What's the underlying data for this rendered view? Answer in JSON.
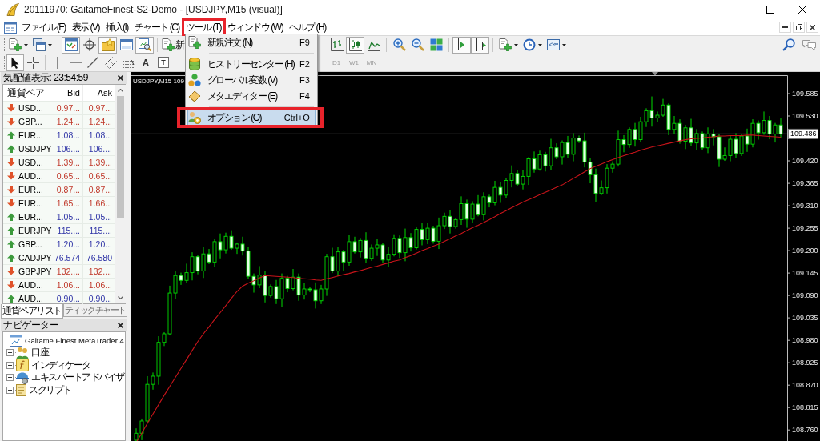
{
  "window": {
    "title": "20111970: GaitameFinest-S2-Demo - [USDJPY,M15 (visual)]"
  },
  "menu_bar": [
    {
      "label": "ファイル (F)",
      "annotated": false
    },
    {
      "label": "表示 (V)",
      "annotated": false
    },
    {
      "label": "挿入(I)",
      "annotated": false
    },
    {
      "label": "チャート (C)",
      "annotated": false
    },
    {
      "label": "ツール (T)",
      "annotated": true,
      "entries": [
        {
          "kind": "item",
          "label": "新規注文 (N)",
          "shortcut": "F9",
          "selected": false,
          "annotated": false
        },
        {
          "kind": "separator"
        },
        {
          "kind": "item",
          "label": "ヒストリーセンター (H)",
          "shortcut": "F2",
          "selected": false,
          "annotated": false
        },
        {
          "kind": "item",
          "label": "グローバル変数 (V)",
          "shortcut": "F3",
          "selected": false,
          "annotated": false
        },
        {
          "kind": "item",
          "label": "メタエディター (E)",
          "shortcut": "F4",
          "selected": false,
          "annotated": false
        },
        {
          "kind": "separator"
        },
        {
          "kind": "item",
          "label": "オプション (O)",
          "shortcut": "Ctrl+O",
          "selected": true,
          "annotated": true
        }
      ]
    },
    {
      "label": "ウィンドウ (W)",
      "annotated": false
    },
    {
      "label": "ヘルプ (H)",
      "annotated": false
    }
  ],
  "toolbar": {
    "left": [
      {
        "pressed": false
      },
      {
        "pressed": false
      },
      {
        "pressed": true
      },
      {
        "pressed": false
      },
      {
        "pressed": true
      },
      {
        "pressed": false
      },
      {
        "pressed": true
      }
    ],
    "order_button": "新",
    "right": [
      {
        "pressed": false
      },
      {
        "pressed": true
      },
      {
        "pressed": false
      },
      {
        "pressed": false
      },
      {
        "pressed": false
      },
      {
        "pressed": false
      },
      {
        "pressed": true
      },
      {
        "pressed": true
      },
      {
        "pressed": false
      },
      {
        "pressed": false
      },
      {
        "pressed": false
      }
    ]
  },
  "drawing_toolbar": {
    "tools": [
      {
        "pressed": true
      },
      {
        "pressed": false
      },
      {
        "pressed": false
      },
      {
        "pressed": false
      },
      {
        "pressed": false
      },
      {
        "pressed": false
      },
      {
        "pressed": false
      }
    ],
    "text_tools": [
      "A",
      "T"
    ],
    "periods": [
      {
        "label": "D1",
        "disabled": true
      },
      {
        "label": "W1",
        "disabled": true
      },
      {
        "label": "MN",
        "disabled": true
      }
    ]
  },
  "market_watch": {
    "title": "気配値表示: 23:54:59",
    "columns": [
      "通貨ペア",
      "Bid",
      "Ask"
    ],
    "rows": [
      {
        "symbol": "USD...",
        "bid": "0.97...",
        "ask": "0.97...",
        "rising": false
      },
      {
        "symbol": "GBP...",
        "bid": "1.24...",
        "ask": "1.24...",
        "rising": false
      },
      {
        "symbol": "EUR...",
        "bid": "1.08...",
        "ask": "1.08...",
        "rising": true
      },
      {
        "symbol": "USDJPY",
        "bid": "106....",
        "ask": "106....",
        "rising": true
      },
      {
        "symbol": "USD...",
        "bid": "1.39...",
        "ask": "1.39...",
        "rising": false
      },
      {
        "symbol": "AUD...",
        "bid": "0.65...",
        "ask": "0.65...",
        "rising": false
      },
      {
        "symbol": "EUR...",
        "bid": "0.87...",
        "ask": "0.87...",
        "rising": false
      },
      {
        "symbol": "EUR...",
        "bid": "1.65...",
        "ask": "1.66...",
        "rising": false
      },
      {
        "symbol": "EUR...",
        "bid": "1.05...",
        "ask": "1.05...",
        "rising": true
      },
      {
        "symbol": "EURJPY",
        "bid": "115....",
        "ask": "115....",
        "rising": true
      },
      {
        "symbol": "GBP...",
        "bid": "1.20...",
        "ask": "1.20...",
        "rising": true
      },
      {
        "symbol": "CADJPY",
        "bid": "76.574",
        "ask": "76.580",
        "rising": true
      },
      {
        "symbol": "GBPJPY",
        "bid": "132....",
        "ask": "132....",
        "rising": false
      },
      {
        "symbol": "AUD...",
        "bid": "1.06...",
        "ask": "1.06...",
        "rising": false
      },
      {
        "symbol": "AUD...",
        "bid": "0.90...",
        "ask": "0.90...",
        "rising": true
      }
    ],
    "tabs": [
      {
        "label": "通貨ペアリスト",
        "selected": true
      },
      {
        "label": "ティックチャート",
        "selected": false
      }
    ]
  },
  "navigator": {
    "title": "ナビゲーター",
    "root": {
      "label": "Gaitame Finest MetaTrader 4",
      "children": [
        {
          "label": "口座",
          "expanded": false
        },
        {
          "label": "インディケータ",
          "expanded": false
        },
        {
          "label": "エキスパートアドバイザ",
          "expanded": false
        },
        {
          "label": "スクリプト",
          "expanded": false
        }
      ]
    }
  },
  "chart": {
    "label": "USDJPY,M15 109",
    "chart_data": {
      "type": "candlestick",
      "categories": [
        null,
        null,
        null,
        null,
        null,
        null,
        null,
        null,
        null,
        null,
        null,
        null,
        null,
        null,
        null,
        null,
        null,
        null,
        null,
        null,
        null,
        null,
        null,
        null,
        null,
        null,
        null,
        null,
        null,
        null,
        null,
        null,
        null,
        null,
        null,
        null,
        null,
        null,
        null,
        null,
        null,
        null,
        null,
        null,
        null,
        null,
        null,
        null,
        null,
        null,
        null,
        null,
        null,
        null,
        null,
        null,
        null,
        null,
        null,
        null,
        null,
        null,
        null,
        null,
        null,
        null,
        null,
        null,
        null,
        null,
        null,
        null,
        null,
        null,
        null,
        null,
        null,
        null,
        null,
        null,
        null,
        null,
        null,
        null,
        null,
        null,
        null,
        null,
        null,
        null,
        null,
        null,
        null,
        null,
        null,
        null,
        null,
        null,
        null,
        null,
        null,
        null,
        null,
        null,
        null,
        null,
        null,
        null,
        null,
        null,
        null,
        null,
        null,
        null,
        null,
        null
      ],
      "ohlc": [
        [
          108.735,
          108.764,
          108.73,
          108.752
        ],
        [
          108.752,
          108.788,
          108.735,
          108.782
        ],
        [
          108.782,
          108.892,
          108.777,
          108.872
        ],
        [
          108.872,
          108.901,
          108.859,
          108.892
        ],
        [
          108.892,
          108.99,
          108.871,
          108.975
        ],
        [
          108.975,
          109,
          108.966,
          108.996
        ],
        [
          108.996,
          109.114,
          108.992,
          109.096
        ],
        [
          109.096,
          109.149,
          109.082,
          109.139
        ],
        [
          109.139,
          109.146,
          109.116,
          109.127
        ],
        [
          109.127,
          109.168,
          109.121,
          109.146
        ],
        [
          109.146,
          109.196,
          109.127,
          109.185
        ],
        [
          109.185,
          109.19,
          109.142,
          109.15
        ],
        [
          109.15,
          109.208,
          109.133,
          109.192
        ],
        [
          109.192,
          109.204,
          109.167,
          109.172
        ],
        [
          109.172,
          109.228,
          109.159,
          109.222
        ],
        [
          109.222,
          109.242,
          109.181,
          109.202
        ],
        [
          109.202,
          109.244,
          109.193,
          109.235
        ],
        [
          109.235,
          109.25,
          109.202,
          109.206
        ],
        [
          109.206,
          109.22,
          109.192,
          109.216
        ],
        [
          109.216,
          109.234,
          109.188,
          109.199
        ],
        [
          109.199,
          109.209,
          109.131,
          109.137
        ],
        [
          109.137,
          109.144,
          109.097,
          109.116
        ],
        [
          109.116,
          109.162,
          109.108,
          109.14
        ],
        [
          109.14,
          109.151,
          109.073,
          109.09
        ],
        [
          109.09,
          109.117,
          109.085,
          109.112
        ],
        [
          109.112,
          109.128,
          109.069,
          109.082
        ],
        [
          109.082,
          109.144,
          109.061,
          109.132
        ],
        [
          109.132,
          109.138,
          109.098,
          109.107
        ],
        [
          109.107,
          109.155,
          109.103,
          109.135
        ],
        [
          109.135,
          109.144,
          109.077,
          109.091
        ],
        [
          109.091,
          109.121,
          109.08,
          109.106
        ],
        [
          109.106,
          109.11,
          109.098,
          109.104
        ],
        [
          109.104,
          109.122,
          109.058,
          109.077
        ],
        [
          109.077,
          109.116,
          109.069,
          109.106
        ],
        [
          109.106,
          109.192,
          109.089,
          109.185
        ],
        [
          109.185,
          109.207,
          109.145,
          109.15
        ],
        [
          109.15,
          109.208,
          109.137,
          109.197
        ],
        [
          109.197,
          109.202,
          109.151,
          109.172
        ],
        [
          109.172,
          109.238,
          109.163,
          109.222
        ],
        [
          109.222,
          109.234,
          109.193,
          109.197
        ],
        [
          109.197,
          109.231,
          109.183,
          109.225
        ],
        [
          109.225,
          109.245,
          109.17,
          109.181
        ],
        [
          109.181,
          109.215,
          109.175,
          109.206
        ],
        [
          109.206,
          109.229,
          109.187,
          109.214
        ],
        [
          109.214,
          109.218,
          109.169,
          109.177
        ],
        [
          109.177,
          109.209,
          109.16,
          109.191
        ],
        [
          109.191,
          109.24,
          109.186,
          109.23
        ],
        [
          109.23,
          109.237,
          109.182,
          109.195
        ],
        [
          109.195,
          109.254,
          109.174,
          109.232
        ],
        [
          109.232,
          109.243,
          109.198,
          109.207
        ],
        [
          109.207,
          109.257,
          109.203,
          109.252
        ],
        [
          109.252,
          109.268,
          109.213,
          109.227
        ],
        [
          109.227,
          109.267,
          109.216,
          109.255
        ],
        [
          109.255,
          109.261,
          109.217,
          109.223
        ],
        [
          109.223,
          109.281,
          109.204,
          109.261
        ],
        [
          109.261,
          109.293,
          109.253,
          109.284
        ],
        [
          109.284,
          109.299,
          109.242,
          109.259
        ],
        [
          109.259,
          109.28,
          109.254,
          109.276
        ],
        [
          109.276,
          109.333,
          109.263,
          109.315
        ],
        [
          109.315,
          109.325,
          109.256,
          109.277
        ],
        [
          109.277,
          109.321,
          109.268,
          109.314
        ],
        [
          109.314,
          109.336,
          109.284,
          109.288
        ],
        [
          109.288,
          109.343,
          109.274,
          109.332
        ],
        [
          109.332,
          109.337,
          109.306,
          109.317
        ],
        [
          109.317,
          109.371,
          109.311,
          109.355
        ],
        [
          109.355,
          109.367,
          109.317,
          109.336
        ],
        [
          109.336,
          109.378,
          109.328,
          109.372
        ],
        [
          109.372,
          109.409,
          109.355,
          109.389
        ],
        [
          109.389,
          109.398,
          109.358,
          109.363
        ],
        [
          109.363,
          109.397,
          109.35,
          109.382
        ],
        [
          109.382,
          109.429,
          109.361,
          109.425
        ],
        [
          109.425,
          109.443,
          109.391,
          109.4
        ],
        [
          109.4,
          109.445,
          109.396,
          109.435
        ],
        [
          109.435,
          109.442,
          109.394,
          109.408
        ],
        [
          109.408,
          109.474,
          109.397,
          109.452
        ],
        [
          109.452,
          109.463,
          109.424,
          109.43
        ],
        [
          109.43,
          109.47,
          109.411,
          109.465
        ],
        [
          109.465,
          109.481,
          109.428,
          109.436
        ],
        [
          109.436,
          109.488,
          109.419,
          109.476
        ],
        [
          109.476,
          109.482,
          109.464,
          109.469
        ],
        [
          109.469,
          109.489,
          109.404,
          109.417
        ],
        [
          109.417,
          109.426,
          109.365,
          109.386
        ],
        [
          109.386,
          109.401,
          109.32,
          109.34
        ],
        [
          109.34,
          109.372,
          109.336,
          109.354
        ],
        [
          109.354,
          109.412,
          109.34,
          109.402
        ],
        [
          109.402,
          109.419,
          109.391,
          109.412
        ],
        [
          109.412,
          109.494,
          109.406,
          109.472
        ],
        [
          109.472,
          109.483,
          109.441,
          109.46
        ],
        [
          109.46,
          109.502,
          109.452,
          109.497
        ],
        [
          109.497,
          109.513,
          109.455,
          109.472
        ],
        [
          109.472,
          109.528,
          109.467,
          109.516
        ],
        [
          109.516,
          109.549,
          109.503,
          109.543
        ],
        [
          109.543,
          109.578,
          109.504,
          109.525
        ],
        [
          109.525,
          109.541,
          109.516,
          109.532
        ],
        [
          109.532,
          109.572,
          109.528,
          109.557
        ],
        [
          109.557,
          109.561,
          109.483,
          109.497
        ],
        [
          109.497,
          109.53,
          109.486,
          109.512
        ],
        [
          109.512,
          109.522,
          109.462,
          109.468
        ],
        [
          109.468,
          109.508,
          109.449,
          109.501
        ],
        [
          109.501,
          109.523,
          109.456,
          109.464
        ],
        [
          109.464,
          109.498,
          109.447,
          109.487
        ],
        [
          109.487,
          109.492,
          109.447,
          109.452
        ],
        [
          109.452,
          109.502,
          109.439,
          109.486
        ],
        [
          109.486,
          109.498,
          109.458,
          109.479
        ],
        [
          109.479,
          109.485,
          109.405,
          109.424
        ],
        [
          109.424,
          109.453,
          109.42,
          109.433
        ],
        [
          109.433,
          109.482,
          109.419,
          109.473
        ],
        [
          109.473,
          109.488,
          109.427,
          109.438
        ],
        [
          109.438,
          109.485,
          109.432,
          109.481
        ],
        [
          109.481,
          109.499,
          109.442,
          109.461
        ],
        [
          109.461,
          109.522,
          109.453,
          109.512
        ],
        [
          109.512,
          109.519,
          109.472,
          109.489
        ],
        [
          109.489,
          109.541,
          109.484,
          109.519
        ],
        [
          109.519,
          109.53,
          109.473,
          109.486
        ],
        [
          109.486,
          109.513,
          109.465,
          109.508
        ],
        [
          109.508,
          109.524,
          109.477,
          109.486
        ]
      ],
      "series": [
        {
          "type": "line",
          "color": "#c8141a",
          "values": [
            108.729,
            108.752,
            108.776,
            108.799,
            108.822,
            108.845,
            108.867,
            108.889,
            108.911,
            108.933,
            108.955,
            108.977,
            108.996,
            109.013,
            109.031,
            109.048,
            109.065,
            109.083,
            109.1,
            109.113,
            109.12,
            109.126,
            109.133,
            109.139,
            109.138,
            109.137,
            109.136,
            109.135,
            109.134,
            109.132,
            109.131,
            109.13,
            109.128,
            109.127,
            109.131,
            109.134,
            109.138,
            109.141,
            109.144,
            109.148,
            109.151,
            109.155,
            109.159,
            109.162,
            109.166,
            109.17,
            109.174,
            109.177,
            109.183,
            109.188,
            109.194,
            109.2,
            109.205,
            109.211,
            109.216,
            109.223,
            109.229,
            109.236,
            109.242,
            109.249,
            109.256,
            109.262,
            109.269,
            109.276,
            109.283,
            109.291,
            109.298,
            109.305,
            109.312,
            109.319,
            109.325,
            109.331,
            109.337,
            109.343,
            109.349,
            109.355,
            109.361,
            109.369,
            109.377,
            109.385,
            109.393,
            109.401,
            109.407,
            109.412,
            109.418,
            109.423,
            109.428,
            109.433,
            109.437,
            109.441,
            109.446,
            109.45,
            109.454,
            109.457,
            109.46,
            109.463,
            109.466,
            109.469,
            109.472,
            109.474,
            109.475,
            109.476,
            109.478,
            109.479,
            109.481,
            109.481,
            109.482,
            109.482,
            109.482,
            109.483,
            109.483,
            109.482,
            109.481,
            109.48,
            109.479,
            109.478
          ]
        }
      ],
      "ref_lines": [
        {
          "axis": "y",
          "value": 109.486,
          "label": "109.486",
          "color": "#a9a9a9"
        }
      ],
      "ylim": [
        108.729,
        109.638
      ],
      "yticks": [
        {
          "value": 109.585,
          "label": "109.585"
        },
        {
          "value": 109.53,
          "label": "109.530"
        },
        {
          "value": 109.42,
          "label": "109.420"
        },
        {
          "value": 109.365,
          "label": "109.365"
        },
        {
          "value": 109.31,
          "label": "109.310"
        },
        {
          "value": 109.255,
          "label": "109.255"
        },
        {
          "value": 109.2,
          "label": "109.200"
        },
        {
          "value": 109.145,
          "label": "109.145"
        },
        {
          "value": 109.09,
          "label": "109.090"
        },
        {
          "value": 109.035,
          "label": "109.035"
        },
        {
          "value": 108.98,
          "label": "108.980"
        },
        {
          "value": 108.925,
          "label": "108.925"
        },
        {
          "value": 108.87,
          "label": "108.870"
        },
        {
          "value": 108.815,
          "label": "108.815"
        },
        {
          "value": 108.76,
          "label": "108.760"
        }
      ]
    }
  }
}
